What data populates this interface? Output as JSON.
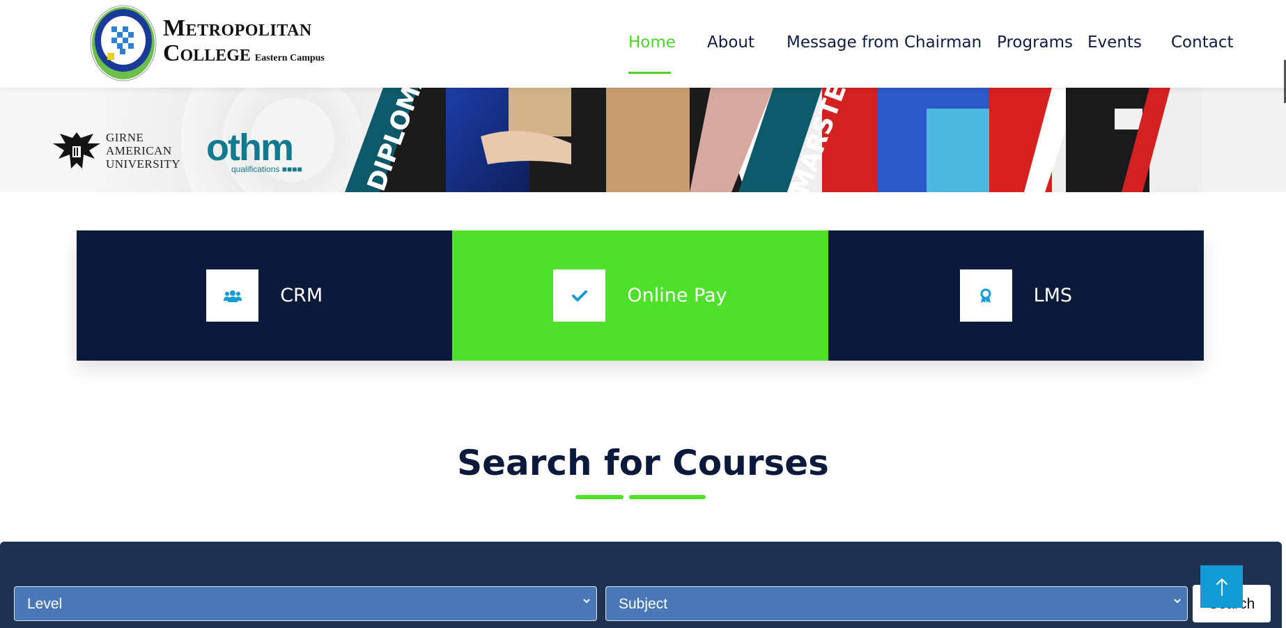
{
  "header": {
    "logo": {
      "line1": "Metropolitan",
      "line2": "College",
      "campus": "Eastern Campus"
    },
    "nav": [
      {
        "label": "Home",
        "active": true
      },
      {
        "label": "About"
      },
      {
        "label": "Message from Chairman"
      },
      {
        "label": "Programs"
      },
      {
        "label": "Events"
      },
      {
        "label": "Contact"
      }
    ]
  },
  "banner": {
    "partner1": {
      "line1": "GIRNE",
      "line2": "AMERICAN",
      "line3": "UNIVERSITY"
    },
    "partner2": {
      "word": "othm",
      "sub": "qualifications"
    },
    "label1": "DIPLOMA",
    "label2": "MARSTER"
  },
  "services": [
    {
      "label": "CRM",
      "icon": "users-icon",
      "style": "dark"
    },
    {
      "label": "Online Pay",
      "icon": "check-icon",
      "style": "green"
    },
    {
      "label": "LMS",
      "icon": "award-icon",
      "style": "dark"
    }
  ],
  "search": {
    "title": "Search for Courses",
    "level_placeholder": "Level",
    "subject_placeholder": "Subject",
    "button_label": "Search"
  },
  "colors": {
    "navy": "#0b1a3b",
    "green": "#4ee02a",
    "panel": "#1f3150",
    "select": "#4a78b6",
    "accent_blue": "#139bd6"
  }
}
